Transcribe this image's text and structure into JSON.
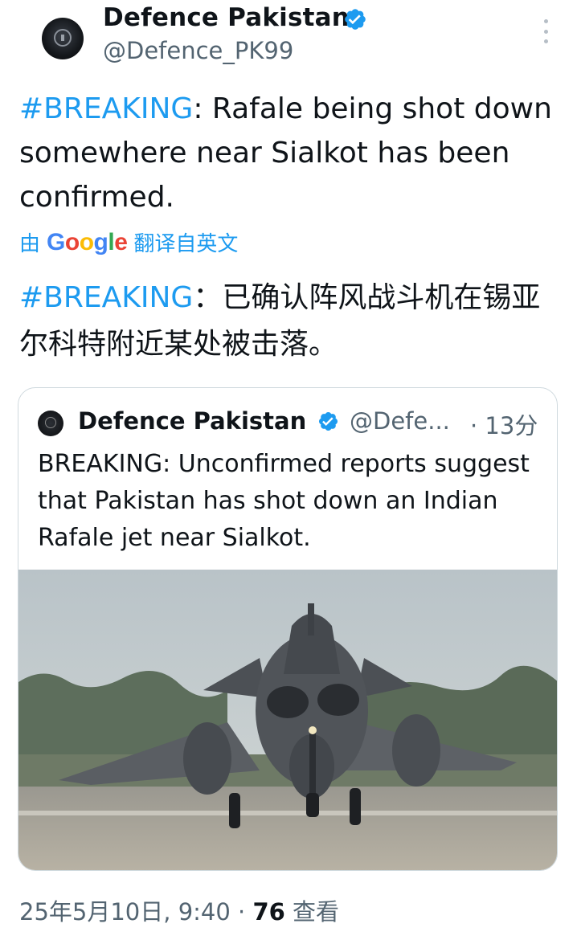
{
  "post": {
    "author_name": "Defence Pakistan",
    "author_handle": "@Defence_PK99",
    "hashtag": "#BREAKING",
    "text_rest": ": Rafale being shot down somewhere near Sialkot has been confirmed.",
    "translate_prefix": "由",
    "translate_suffix": "翻译自英文",
    "translated_hashtag": "#BREAKING",
    "translated_rest": "：已确认阵风战斗机在锡亚尔科特附近某处被击落。"
  },
  "quote": {
    "author_name": "Defence Pakistan",
    "author_handle": "@Defe...",
    "time": "· 13分",
    "text": "BREAKING: Unconfirmed reports suggest that Pakistan has shot down an Indian Rafale jet near Sialkot."
  },
  "footer": {
    "datetime": "25年5月10日, 9:40 · ",
    "views_count": "76",
    "views_label": " 查看"
  },
  "icons": {
    "verified": "verified-badge-icon",
    "more": "more-options-icon",
    "google": "google-logo"
  },
  "colors": {
    "link": "#1d9bf0",
    "muted": "#536471",
    "text": "#0f1419"
  }
}
